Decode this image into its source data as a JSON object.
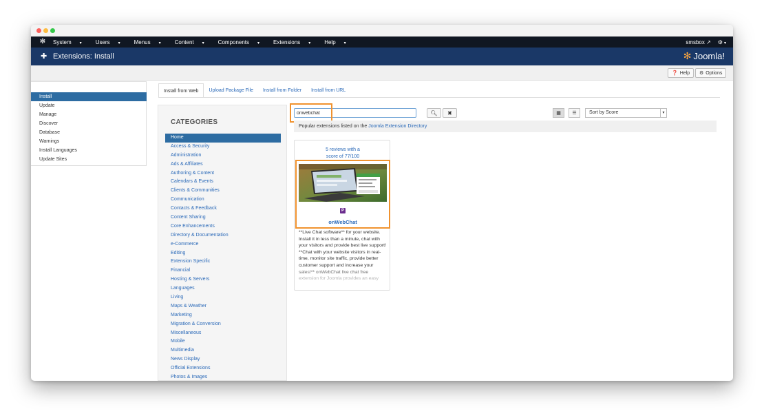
{
  "topnav": {
    "menu": [
      "System",
      "Users",
      "Menus",
      "Content",
      "Components",
      "Extensions",
      "Help"
    ],
    "user": "smsbox"
  },
  "header": {
    "title": "Extensions: Install",
    "brand": "Joomla!"
  },
  "toolbar": {
    "help_label": "Help",
    "options_label": "Options"
  },
  "sidebar": {
    "items": [
      "Install",
      "Update",
      "Manage",
      "Discover",
      "Database",
      "Warnings",
      "Install Languages",
      "Update Sites"
    ],
    "active": "Install"
  },
  "tabs": [
    "Install from Web",
    "Upload Package File",
    "Install from Folder",
    "Install from URL"
  ],
  "categories": {
    "title": "CATEGORIES",
    "items": [
      "Home",
      "Access & Security",
      "Administration",
      "Ads & Affiliates",
      "Authoring & Content",
      "Calendars & Events",
      "Clients & Communities",
      "Communication",
      "Contacts & Feedback",
      "Content Sharing",
      "Core Enhancements",
      "Directory & Documentation",
      "e-Commerce",
      "Editing",
      "Extension Specific",
      "Financial",
      "Hosting & Servers",
      "Languages",
      "Living",
      "Maps & Weather",
      "Marketing",
      "Migration & Conversion",
      "Miscellaneous",
      "Mobile",
      "Multimedia",
      "News Display",
      "Official Extensions",
      "Photos & Images"
    ]
  },
  "search": {
    "value": "onwebchat"
  },
  "sort": {
    "selected": "Sort by Score"
  },
  "info": {
    "text": "Popular extensions listed on the",
    "link": "Joomla Extension Directory"
  },
  "extension": {
    "reviews_line1": "5 reviews with a",
    "reviews_line2": "score of 77/100",
    "type_badge": "P",
    "name": "onWebChat",
    "description": "**Live Chat software** for your website. Install it in less than a minute, chat with your visitors and provide best live support! **Chat with your website visitors in real-time, monitor site traffic, provide better customer support and increase your sales!** onWebChat live chat free extension for Joomla provides an easy"
  },
  "colors": {
    "navbar": "#101722",
    "header": "#1a3867",
    "accent": "#2d6ca2",
    "highlight": "#f0922e"
  }
}
